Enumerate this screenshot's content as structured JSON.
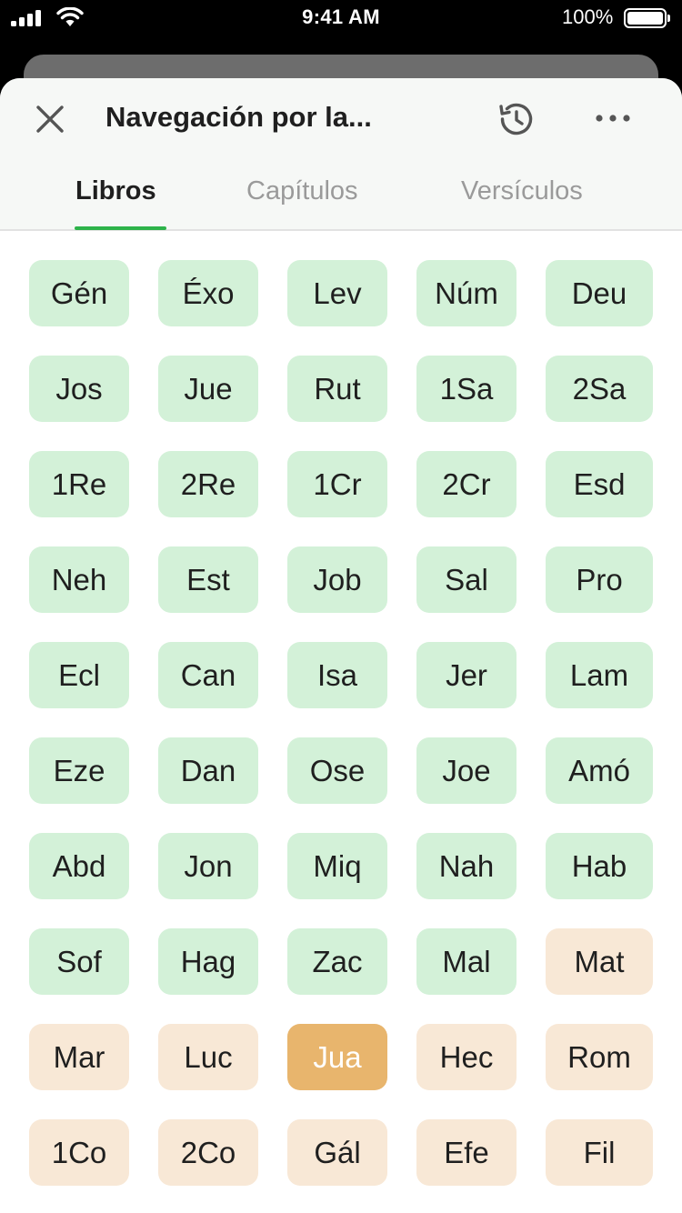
{
  "status_bar": {
    "time": "9:41 AM",
    "battery": "100%"
  },
  "header": {
    "title": "Navegación por la...",
    "tabs": [
      {
        "label": "Libros"
      },
      {
        "label": "Capítulos"
      },
      {
        "label": "Versículos"
      }
    ]
  },
  "colors": {
    "accent": "#2db34a",
    "old_testament": "#d3f1d8",
    "new_testament": "#f8e8d6",
    "selected": "#e8b56d"
  },
  "books": [
    {
      "label": "Gén",
      "testament": "ot"
    },
    {
      "label": "Éxo",
      "testament": "ot"
    },
    {
      "label": "Lev",
      "testament": "ot"
    },
    {
      "label": "Núm",
      "testament": "ot"
    },
    {
      "label": "Deu",
      "testament": "ot"
    },
    {
      "label": "Jos",
      "testament": "ot"
    },
    {
      "label": "Jue",
      "testament": "ot"
    },
    {
      "label": "Rut",
      "testament": "ot"
    },
    {
      "label": "1Sa",
      "testament": "ot"
    },
    {
      "label": "2Sa",
      "testament": "ot"
    },
    {
      "label": "1Re",
      "testament": "ot"
    },
    {
      "label": "2Re",
      "testament": "ot"
    },
    {
      "label": "1Cr",
      "testament": "ot"
    },
    {
      "label": "2Cr",
      "testament": "ot"
    },
    {
      "label": "Esd",
      "testament": "ot"
    },
    {
      "label": "Neh",
      "testament": "ot"
    },
    {
      "label": "Est",
      "testament": "ot"
    },
    {
      "label": "Job",
      "testament": "ot"
    },
    {
      "label": "Sal",
      "testament": "ot"
    },
    {
      "label": "Pro",
      "testament": "ot"
    },
    {
      "label": "Ecl",
      "testament": "ot"
    },
    {
      "label": "Can",
      "testament": "ot"
    },
    {
      "label": "Isa",
      "testament": "ot"
    },
    {
      "label": "Jer",
      "testament": "ot"
    },
    {
      "label": "Lam",
      "testament": "ot"
    },
    {
      "label": "Eze",
      "testament": "ot"
    },
    {
      "label": "Dan",
      "testament": "ot"
    },
    {
      "label": "Ose",
      "testament": "ot"
    },
    {
      "label": "Joe",
      "testament": "ot"
    },
    {
      "label": "Amó",
      "testament": "ot"
    },
    {
      "label": "Abd",
      "testament": "ot"
    },
    {
      "label": "Jon",
      "testament": "ot"
    },
    {
      "label": "Miq",
      "testament": "ot"
    },
    {
      "label": "Nah",
      "testament": "ot"
    },
    {
      "label": "Hab",
      "testament": "ot"
    },
    {
      "label": "Sof",
      "testament": "ot"
    },
    {
      "label": "Hag",
      "testament": "ot"
    },
    {
      "label": "Zac",
      "testament": "ot"
    },
    {
      "label": "Mal",
      "testament": "ot"
    },
    {
      "label": "Mat",
      "testament": "nt"
    },
    {
      "label": "Mar",
      "testament": "nt"
    },
    {
      "label": "Luc",
      "testament": "nt"
    },
    {
      "label": "Jua",
      "testament": "nt",
      "selected": true
    },
    {
      "label": "Hec",
      "testament": "nt"
    },
    {
      "label": "Rom",
      "testament": "nt"
    },
    {
      "label": "1Co",
      "testament": "nt"
    },
    {
      "label": "2Co",
      "testament": "nt"
    },
    {
      "label": "Gál",
      "testament": "nt"
    },
    {
      "label": "Efe",
      "testament": "nt"
    },
    {
      "label": "Fil",
      "testament": "nt"
    }
  ]
}
